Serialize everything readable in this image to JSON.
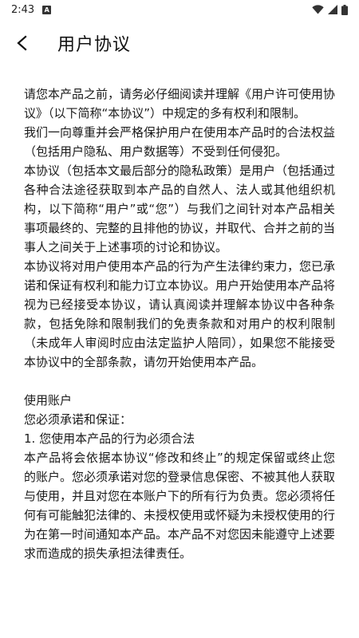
{
  "status_bar": {
    "time": "2:43",
    "notification_icon": "a-badge-icon",
    "wifi_icon": "wifi-icon",
    "signal_icon": "signal-icon",
    "battery_icon": "battery-icon"
  },
  "header": {
    "back_icon": "back-arrow-icon",
    "title": "用户协议"
  },
  "agreement": {
    "paragraphs": [
      "请您本产品之前，请务必仔细阅读并理解《用户许可使用协议》（以下简称“本协议”）中规定的多有权利和限制。",
      "我们一向尊重并会严格保护用户在使用本产品时的合法权益（包括用户隐私、用户数据等）不受到任何侵犯。",
      "本协议（包括本文最后部分的隐私政策）是用户（包括通过各种合法途径获取到本产品的自然人、法人或其他组织机构，以下简称“用户”或“您”）与我们之间针对本产品相关事项最终的、完整的且排他的协议，并取代、合并之前的当事人之间关于上述事项的讨论和协议。",
      "本协议将对用户使用本产品的行为产生法律约束力，您已承诺和保证有权利和能力订立本协议。用户开始使用本产品将视为已经接受本协议，请认真阅读并理解本协议中各种条款，包括免除和限制我们的免责条款和对用户的权利限制（未成年人审阅时应由法定监护人陪同），如果您不能接受本协议中的全部条款，请勿开始使用本产品。"
    ],
    "section_title": "使用账户",
    "section_intro": "您必须承诺和保证：",
    "item_1_title": "1. 您使用本产品的行为必须合法",
    "item_1_body": "本产品将会依据本协议“修改和终止”的规定保留或终止您的账户。您必须承诺对您的登录信息保密、不被其他人获取与使用，并且对您在本账户下的所有行为负责。您必须将任何有可能触犯法律的、未授权使用或怀疑为未授权使用的行为在第一时间通知本产品。本产品不对您因未能遵守上述要求而造成的损失承担法律责任。"
  }
}
